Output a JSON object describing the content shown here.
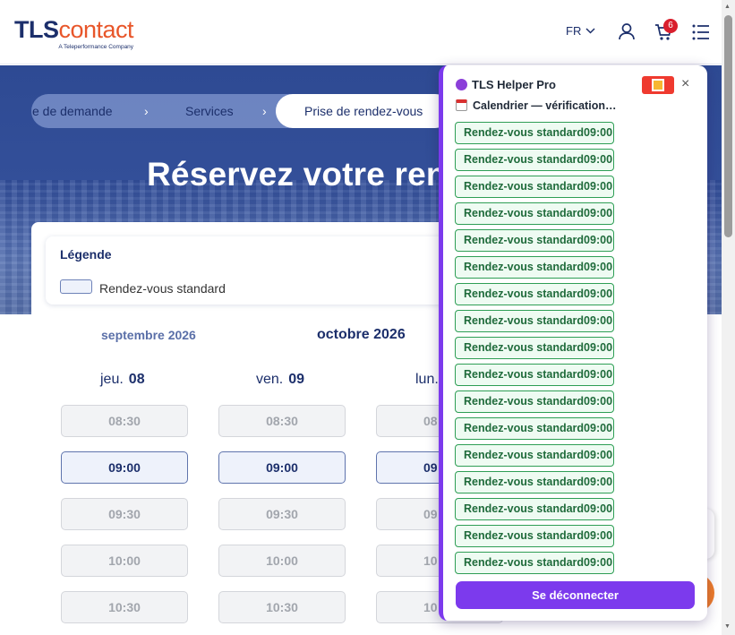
{
  "header": {
    "logo_tls": "TLS",
    "logo_contact": "contact",
    "logo_tagline": "A Teleperformance Company",
    "language": "FR",
    "cart_count": "6"
  },
  "hero": {
    "breadcrumb": [
      "e de demande",
      "Services",
      "Prise de rendez-vous"
    ],
    "title": "Réservez votre ren"
  },
  "legend": {
    "title": "Légende",
    "standard_label": "Rendez-vous standard"
  },
  "calendar": {
    "prev_month": "septembre 2026",
    "current_month": "octobre 2026",
    "days": [
      {
        "name": "jeu.",
        "num": "08"
      },
      {
        "name": "ven.",
        "num": "09"
      },
      {
        "name": "lun.",
        "num": ""
      }
    ],
    "times": [
      "08:30",
      "09:00",
      "09:30",
      "10:00",
      "10:30"
    ],
    "partial_times": [
      "08",
      "09",
      "09",
      "10",
      "10"
    ],
    "available_time": "09:00"
  },
  "extension": {
    "title": "TLS Helper Pro",
    "status": "Calendrier — vérification…",
    "slot_entry": "Rendez-vous standard09:00",
    "slot_count": 17,
    "logout_label": "Se déconnecter",
    "close_label": "×",
    "accent": "#7c3aed",
    "success": "#2e9e55"
  },
  "colors": {
    "brand_navy": "#1c2f6b",
    "brand_orange": "#e8562a"
  }
}
